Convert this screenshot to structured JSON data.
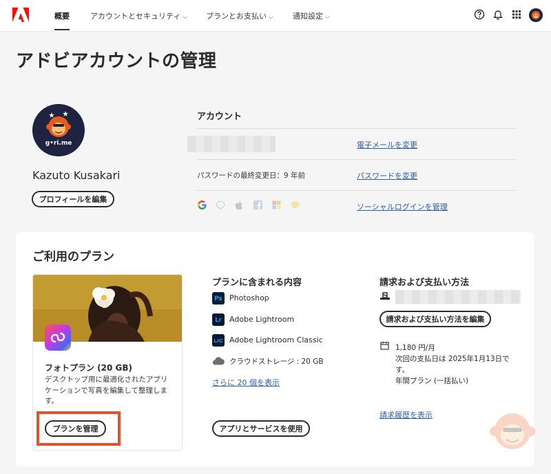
{
  "nav": {
    "items": [
      {
        "label": "概要",
        "active": true
      },
      {
        "label": "アカウントとセキュリティ"
      },
      {
        "label": "プランとお支払い"
      },
      {
        "label": "通知設定"
      }
    ],
    "chevron": "⌵",
    "icons": [
      "help-icon",
      "bell-icon",
      "apps-grid-icon"
    ],
    "avatar_text": "g•ri.me"
  },
  "page": {
    "title": "アドビアカウントの管理"
  },
  "profile": {
    "name": "Kazuto Kusakari",
    "edit_label": "プロフィールを編集",
    "avatar_text": "g•ri.me"
  },
  "account": {
    "heading": "アカウント",
    "change_email": "電子メールを変更",
    "password_info": "パスワードの最終変更日：9 年前",
    "change_password": "パスワードを変更",
    "social_icons": [
      "google-icon",
      "line-icon",
      "apple-icon",
      "facebook-icon",
      "microsoft-icon",
      "yahoo-icon"
    ],
    "manage_social": "ソーシャルログインを管理"
  },
  "plan": {
    "heading": "ご利用のプラン",
    "product_title": "フォトプラン (20 GB)",
    "product_desc": "デスクトップ用に最適化されたアプリケーションで写真を編集して整理します。",
    "manage_label": "プランを管理",
    "includes_heading": "プランに含まれる内容",
    "apps": [
      {
        "badge": "Ps",
        "name": "Photoshop"
      },
      {
        "badge": "Lr",
        "name": "Adobe Lightroom"
      },
      {
        "badge": "LrC",
        "name": "Adobe Lightroom Classic"
      },
      {
        "badge": "cloud",
        "name": "クラウドストレージ : 20 GB"
      }
    ],
    "show_more": "さらに 20 個を表示",
    "use_apps_label": "アプリとサービスを使用",
    "billing_heading": "請求および支払い方法",
    "edit_billing_label": "請求および支払い方法を編集",
    "price": "1,180 円/月",
    "next_payment": "次回の支払日は 2025年1月13日です。",
    "plan_type": "年間プラン (一括払い)",
    "billing_history": "請求履歴を表示"
  },
  "colors": {
    "accent_link": "#2d5ca8",
    "highlight": "#e4512a",
    "adobe_red": "#fa0f00"
  }
}
